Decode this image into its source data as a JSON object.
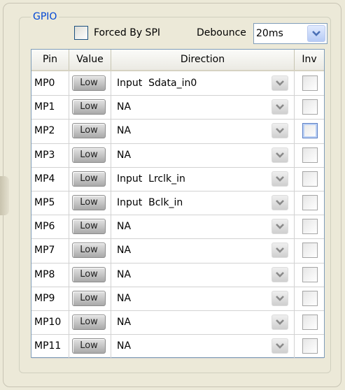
{
  "group": {
    "title": "GPIO",
    "forced_by_spi_label": "Forced By SPI",
    "debounce_label": "Debounce",
    "debounce_value": "20ms"
  },
  "table": {
    "headers": [
      "Pin",
      "Value",
      "Direction",
      "Inv"
    ],
    "rows": [
      {
        "pin": "MP0",
        "value": "Low",
        "direction": "Input  Sdata_in0"
      },
      {
        "pin": "MP1",
        "value": "Low",
        "direction": "NA"
      },
      {
        "pin": "MP2",
        "value": "Low",
        "direction": "NA"
      },
      {
        "pin": "MP3",
        "value": "Low",
        "direction": "NA"
      },
      {
        "pin": "MP4",
        "value": "Low",
        "direction": "Input  Lrclk_in"
      },
      {
        "pin": "MP5",
        "value": "Low",
        "direction": "Input  Bclk_in"
      },
      {
        "pin": "MP6",
        "value": "Low",
        "direction": "NA"
      },
      {
        "pin": "MP7",
        "value": "Low",
        "direction": "NA"
      },
      {
        "pin": "MP8",
        "value": "Low",
        "direction": "NA"
      },
      {
        "pin": "MP9",
        "value": "Low",
        "direction": "NA"
      },
      {
        "pin": "MP10",
        "value": "Low",
        "direction": "NA"
      },
      {
        "pin": "MP11",
        "value": "Low",
        "direction": "NA"
      }
    ]
  },
  "icons": {
    "dropdown": "chevron-down-icon",
    "debounce_dropdown_color": "#4a6fb5",
    "row_dropdown_color": "#8a8a8a"
  }
}
